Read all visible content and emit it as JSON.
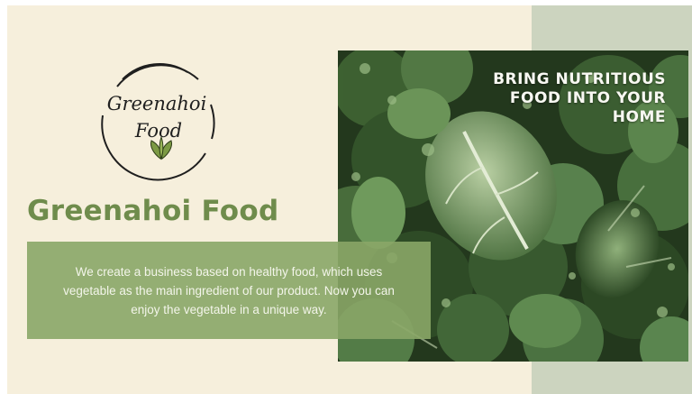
{
  "brand": {
    "name": "Greenahoi Food",
    "logo_line1": "Greenahoi",
    "logo_line2": "Food"
  },
  "tagline": {
    "line1": "BRING NUTRITIOUS",
    "line2": "FOOD INTO YOUR",
    "line3": "HOME"
  },
  "description": {
    "line1": "We create a business based on healthy food, which uses",
    "line2": "vegetable as the main ingredient of our product. Now you can",
    "line3": "enjoy the vegetable in a unique way."
  },
  "colors": {
    "background": "#f6efdc",
    "sage_panel": "#ccd4bf",
    "brand_green": "#6f8c4c",
    "description_box": "#8aa667"
  },
  "icons": {
    "logo_leaf": "leaf-sprout-icon"
  }
}
